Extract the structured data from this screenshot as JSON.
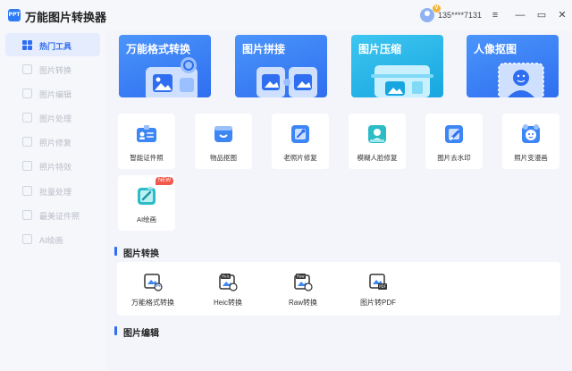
{
  "app": {
    "logo_text": "PPT",
    "title": "万能图片转换器"
  },
  "user": {
    "phone": "135****7131",
    "vip_badge": "V"
  },
  "window": {
    "menu": "≡",
    "minimize": "—",
    "maximize": "▭",
    "close": "✕"
  },
  "sidebar": {
    "items": [
      {
        "label": "热门工具",
        "active": true
      },
      {
        "label": "图片转换"
      },
      {
        "label": "图片编辑"
      },
      {
        "label": "图片处理"
      },
      {
        "label": "照片修复"
      },
      {
        "label": "照片特效"
      },
      {
        "label": "批量处理"
      },
      {
        "label": "最美证件照"
      },
      {
        "label": "AI绘画"
      }
    ]
  },
  "banners": [
    {
      "title": "万能格式转换",
      "color": "#3d86f5"
    },
    {
      "title": "图片拼接",
      "color": "#3d86f5"
    },
    {
      "title": "图片压缩",
      "color": "#22b7e8"
    },
    {
      "title": "人像抠图",
      "color": "#3d86f5"
    }
  ],
  "tools": [
    {
      "label": "智能证件照",
      "icon": "id-card-icon"
    },
    {
      "label": "物品抠图",
      "icon": "cutout-icon"
    },
    {
      "label": "老照片修复",
      "icon": "photo-repair-icon"
    },
    {
      "label": "模糊人脸修复",
      "icon": "face-repair-icon"
    },
    {
      "label": "图片去水印",
      "icon": "watermark-remove-icon"
    },
    {
      "label": "照片变漫画",
      "icon": "cartoon-icon"
    },
    {
      "label": "AI绘画",
      "icon": "ai-paint-icon",
      "badge": "NEW"
    }
  ],
  "sections": {
    "convert": "图片转换",
    "edit": "图片编辑"
  },
  "conversions": [
    {
      "label": "万能格式转换",
      "tag": ""
    },
    {
      "label": "Heic转换",
      "tag": "Heic"
    },
    {
      "label": "Raw转换",
      "tag": "Raw"
    },
    {
      "label": "图片转PDF",
      "tag": "PDF"
    }
  ]
}
